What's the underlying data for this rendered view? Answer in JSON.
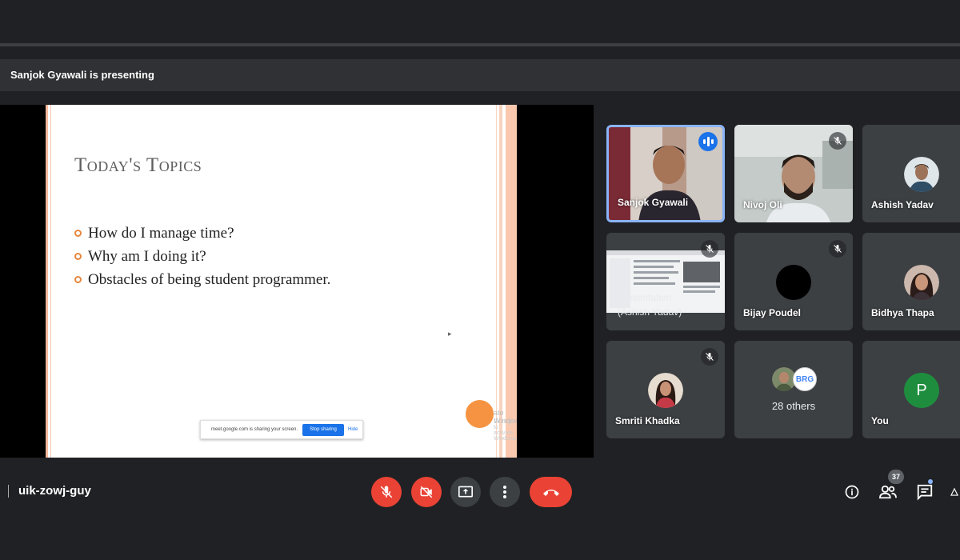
{
  "presenter_banner": "Sanjok Gyawali is presenting",
  "slide": {
    "title": "Today's Topics",
    "bullets": [
      "How do I manage time?",
      "Why am I doing it?",
      "Obstacles of being student programmer."
    ],
    "share_notice": {
      "text": "meet.google.com is sharing your screen.",
      "stop_label": "Stop sharing",
      "hide_label": "Hide"
    },
    "watermark_line1": "ate Windows",
    "watermark_line2": "Settings to activate Windows."
  },
  "participants": [
    {
      "name": "Sanjok Gyawali",
      "state": "speaking",
      "active": true
    },
    {
      "name": "Nivoj Oli",
      "state": "muted"
    },
    {
      "name": "Ashish Yadav",
      "state": "avatar-photo"
    },
    {
      "name_line1": "Presentation",
      "name_line2": "(Ashish Yadav)",
      "state": "muted-presentation"
    },
    {
      "name": "Bijay Poudel",
      "state": "muted"
    },
    {
      "name": "Bidhya Thapa",
      "state": "avatar-photo"
    },
    {
      "name": "Smriti Khadka",
      "state": "muted"
    },
    {
      "label": "28 others",
      "badge_text": "BRG"
    },
    {
      "name": "You",
      "avatar_letter": "P"
    }
  ],
  "meeting_code": "uik-zowj-guy",
  "people_count": "37",
  "colors": {
    "accent": "#1a73e8",
    "end_call": "#ea4335",
    "bullet": "#e8873e",
    "active_border": "#8ab4f8"
  },
  "icons": [
    "mic-off-icon",
    "camera-off-icon",
    "present-icon",
    "more-vert-icon",
    "call-end-icon",
    "info-icon",
    "people-icon",
    "chat-icon",
    "activities-icon"
  ]
}
